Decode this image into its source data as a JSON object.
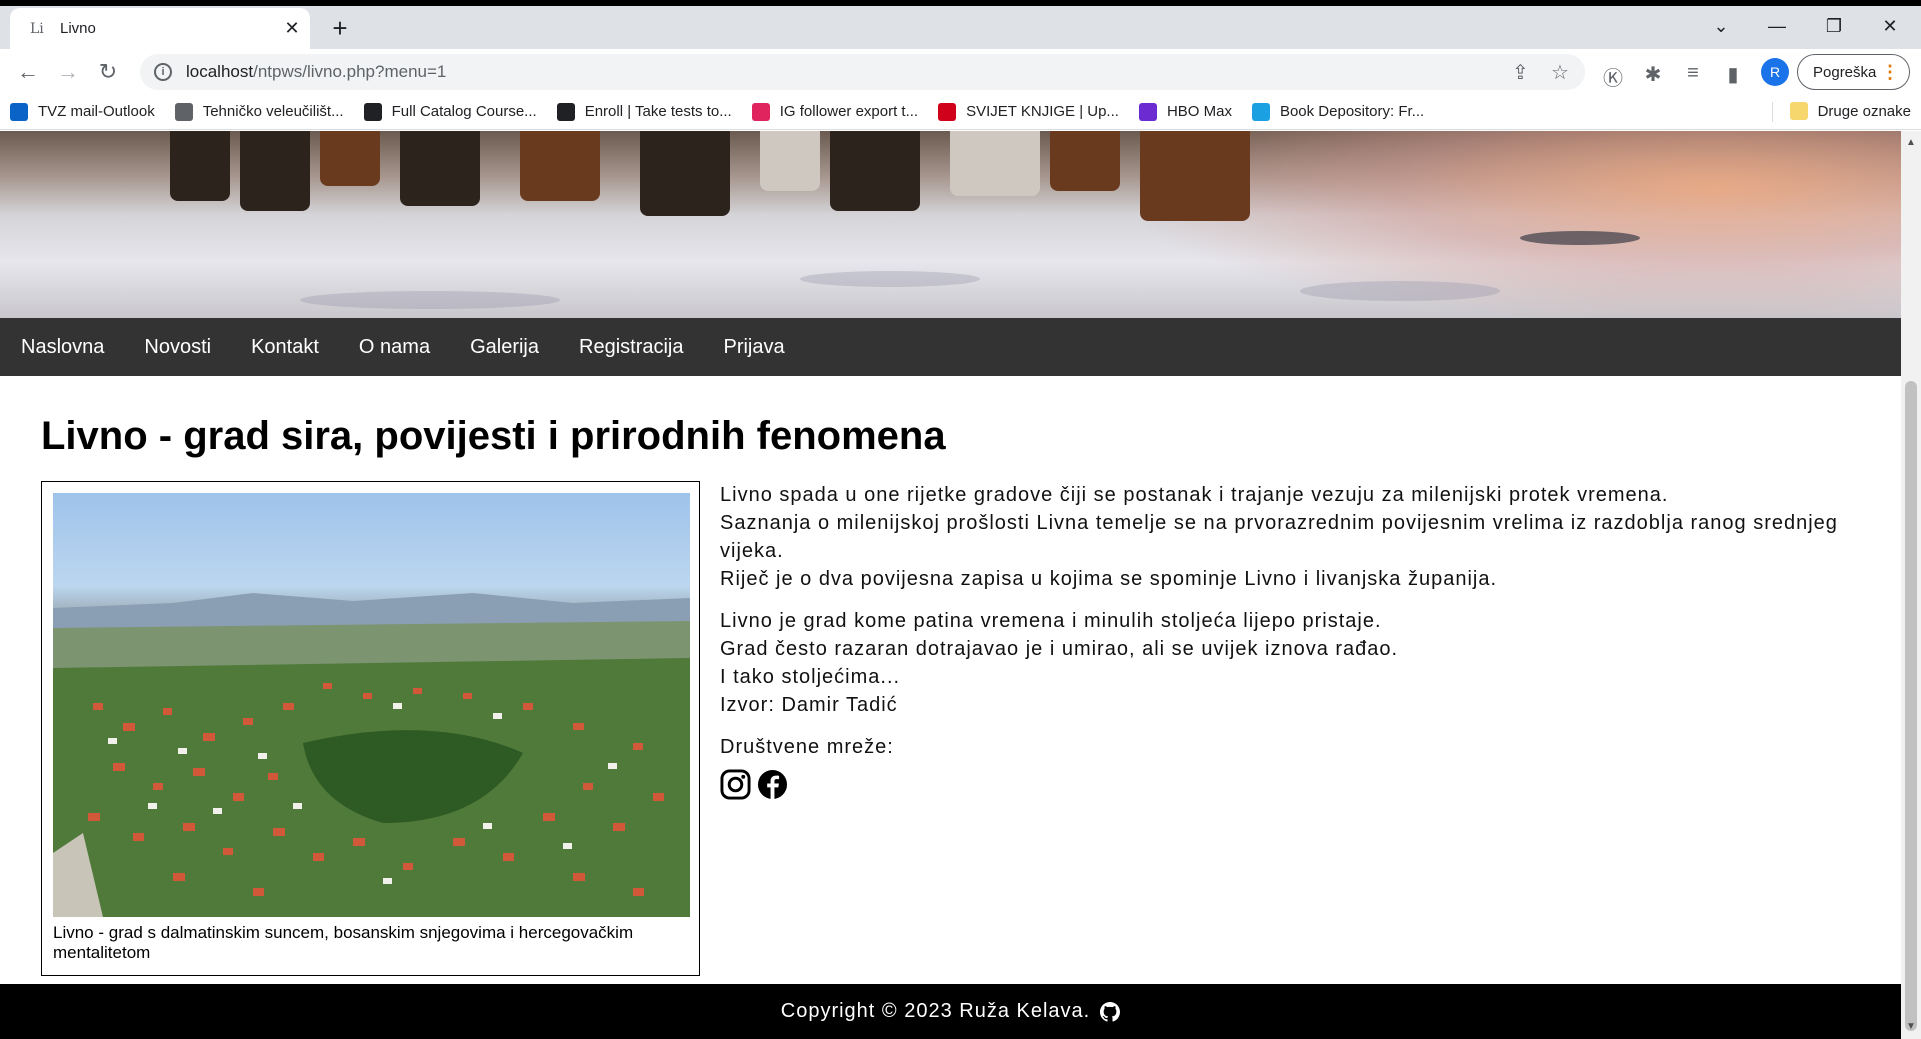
{
  "browser": {
    "tab_favicon": "Li",
    "tab_title": "Livno",
    "url_host": "localhost",
    "url_path": "/ntpws/livno.php?menu=1",
    "profile_initial": "R",
    "error_label": "Pogreška",
    "bookmarks": [
      {
        "label": "TVZ mail-Outlook",
        "icon": "outlook-icon",
        "color": "#0a64c8"
      },
      {
        "label": "Tehničko veleučilišt...",
        "icon": "globe-icon",
        "color": "#5f6368"
      },
      {
        "label": "Full Catalog Course...",
        "icon": "catalog-icon",
        "color": "#202124"
      },
      {
        "label": "Enroll | Take tests to...",
        "icon": "horse-icon",
        "color": "#202124"
      },
      {
        "label": "IG follower export t...",
        "icon": "ig-export-icon",
        "color": "#e0245e"
      },
      {
        "label": "SVIJET KNJIGE | Up...",
        "icon": "svijet-icon",
        "color": "#d0021b"
      },
      {
        "label": "HBO Max",
        "icon": "hbo-icon",
        "color": "#6b2bd1"
      },
      {
        "label": "Book Depository: Fr...",
        "icon": "bookmark-blue-icon",
        "color": "#1ba1e2"
      }
    ],
    "other_bookmarks": "Druge oznake"
  },
  "site": {
    "nav": [
      "Naslovna",
      "Novosti",
      "Kontakt",
      "O nama",
      "Galerija",
      "Registracija",
      "Prijava"
    ],
    "title": "Livno - grad sira, povijesti i prirodnih fenomena",
    "caption": "Livno - grad s dalmatinskim suncem, bosanskim snjegovima i hercegovačkim mentalitetom",
    "paragraphs": [
      [
        "Livno spada u one rijetke gradove čiji se postanak i trajanje vezuju za milenijski protek vremena.",
        "Saznanja o milenijskoj prošlosti Livna temelje se na prvorazrednim povijesnim vrelima iz razdoblja ranog srednjeg vijeka.",
        "Riječ je o dva povijesna zapisa u kojima se spominje Livno i livanjska županija."
      ],
      [
        "Livno je grad kome patina vremena i minulih stoljeća lijepo pristaje.",
        "Grad često razaran dotrajavao je i umirao, ali se uvijek iznova rađao.",
        "I tako stoljećima...",
        "Izvor: Damir Tadić"
      ]
    ],
    "social_label": "Društvene mreže:",
    "footer": "Copyright © 2023 Ruža Kelava."
  }
}
